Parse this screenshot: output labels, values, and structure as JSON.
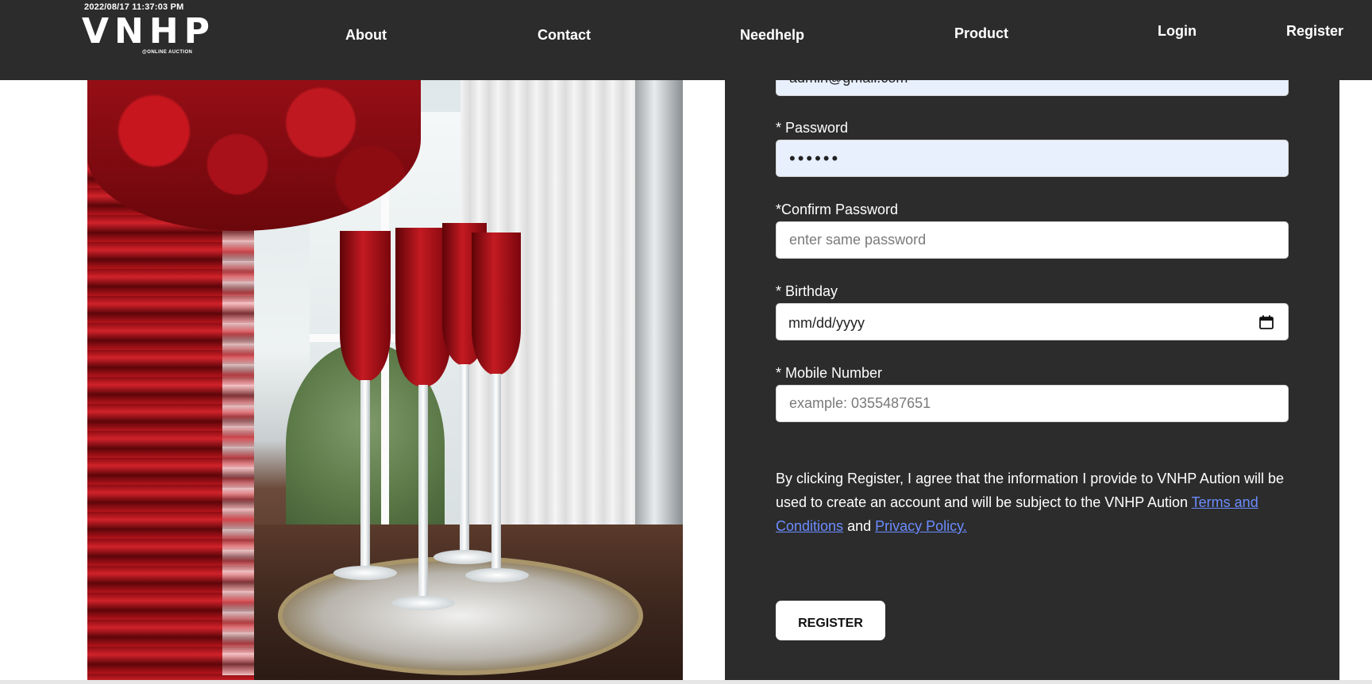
{
  "header": {
    "datetime": "2022/08/17 11:37:03 PM",
    "brand": "VNHP",
    "brand_sub": "@ONLINE AUCTION",
    "nav": {
      "about": "About",
      "contact": "Contact",
      "needhelp": "Needhelp",
      "product": "Product",
      "login": "Login",
      "register": "Register"
    }
  },
  "form": {
    "email_value": "admin@gmail.com",
    "password_label": "* Password",
    "password_value": "••••••",
    "confirm_label": "*Confirm Password",
    "confirm_placeholder": "enter same password",
    "birthday_label": "* Birthday",
    "birthday_placeholder": "mm/dd/yyyy",
    "mobile_label": "* Mobile Number",
    "mobile_placeholder": "example: 0355487651",
    "agreement_text_1": "By clicking Register, I agree that the information I provide to VNHP Aution will be used to create an account and will be subject to the VNHP Aution ",
    "terms_link": "Terms and Conditions",
    "agreement_and": " and ",
    "privacy_link": "Privacy Policy.",
    "register_button": "REGISTER"
  },
  "icons": {
    "calendar": "calendar-icon"
  },
  "colors": {
    "header_bg": "#2c2c2c",
    "panel_bg": "#2c2c2c",
    "link": "#6b8cff",
    "autofill_bg": "#e8f0fe"
  }
}
